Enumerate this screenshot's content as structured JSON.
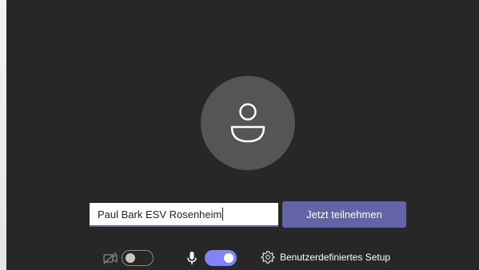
{
  "prejoin": {
    "name_value": "Paul Bark ESV Rosenheim",
    "join_label": "Jetzt teilnehmen",
    "custom_setup_label": "Benutzerdefiniertes Setup"
  },
  "controls": {
    "camera_enabled": false,
    "microphone_enabled": true
  },
  "colors": {
    "background": "#272727",
    "avatar": "#555555",
    "accent": "#6264a7",
    "toggle_on": "#7f85f5"
  },
  "icons": {
    "avatar": "person-avatar-icon",
    "camera": "camera-off-icon",
    "microphone": "microphone-icon",
    "settings": "gear-icon"
  }
}
